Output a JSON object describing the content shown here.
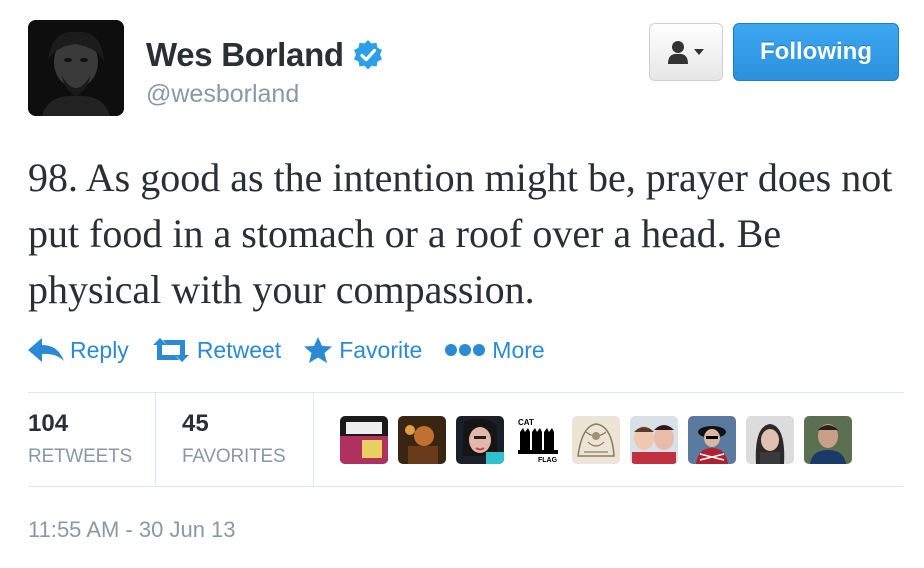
{
  "profile": {
    "name": "Wes Borland",
    "handle": "@wesborland",
    "avatar_icon": "profile-photo",
    "verified": true,
    "verified_icon": "verified-badge-icon"
  },
  "buttons": {
    "user_menu_icon": "person-dropdown-icon",
    "follow_label": "Following"
  },
  "tweet": {
    "text": "98. As good as the intention might be, prayer does not put food in a stomach or a roof over a head. Be physical with your compassion."
  },
  "actions": [
    {
      "label": "Reply",
      "icon": "reply-arrow-icon"
    },
    {
      "label": "Retweet",
      "icon": "retweet-icon"
    },
    {
      "label": "Favorite",
      "icon": "star-icon"
    },
    {
      "label": "More",
      "icon": "more-dots-icon"
    }
  ],
  "stats": {
    "retweets": {
      "count": "104",
      "label": "RETWEETS"
    },
    "favorites": {
      "count": "45",
      "label": "FAVORITES"
    }
  },
  "favoriter_avatars": [
    "favoriter-avatar-1",
    "favoriter-avatar-2",
    "favoriter-avatar-3",
    "favoriter-avatar-4",
    "favoriter-avatar-5",
    "favoriter-avatar-6",
    "favoriter-avatar-7",
    "favoriter-avatar-8",
    "favoriter-avatar-9"
  ],
  "timestamp": "11:55 AM - 30 Jun 13",
  "colors": {
    "link": "#2a8ad4",
    "follow_button": "#2b90dc",
    "muted": "#8899a6",
    "text": "#292f33"
  }
}
